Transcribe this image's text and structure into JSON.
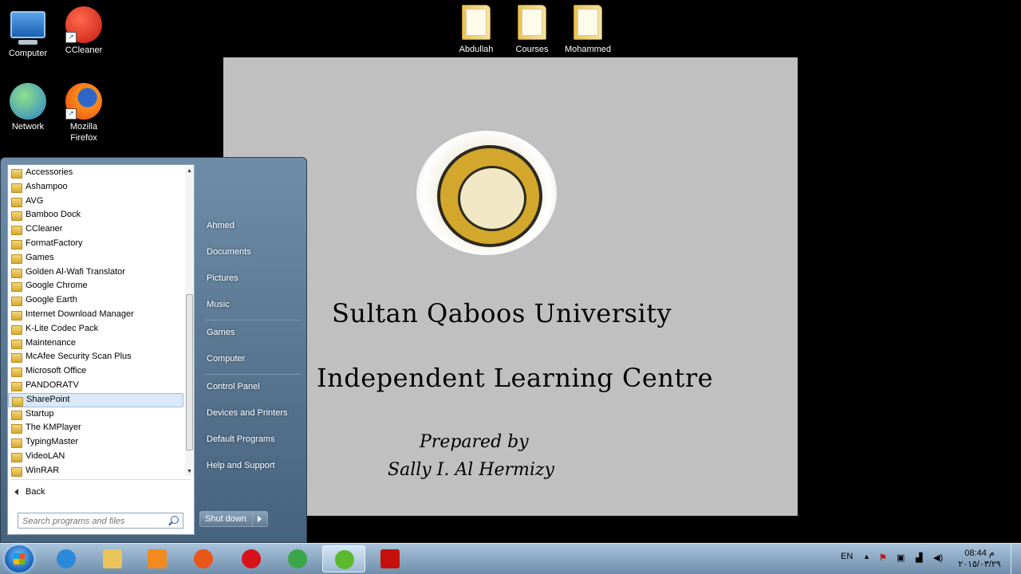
{
  "desktop": {
    "icons": [
      {
        "label": "Computer"
      },
      {
        "label": "CCleaner"
      },
      {
        "label": "Network"
      },
      {
        "label": "Mozilla Firefox"
      },
      {
        "label": "Abdullah"
      },
      {
        "label": "Courses"
      },
      {
        "label": "Mohammed"
      }
    ]
  },
  "slide": {
    "title": "Sultan Qaboos University",
    "subtitle": "Independent Learning Centre",
    "prepared_by": "Prepared by",
    "author": "Sally I. Al Hermizy"
  },
  "start_menu": {
    "programs": [
      "Accessories",
      "Ashampoo",
      "AVG",
      "Bamboo Dock",
      "CCleaner",
      "FormatFactory",
      "Games",
      "Golden Al-Wafi Translator",
      "Google Chrome",
      "Google Earth",
      "Internet Download Manager",
      "K-Lite Codec Pack",
      "Maintenance",
      "McAfee Security Scan Plus",
      "Microsoft Office",
      "PANDORATV",
      "SharePoint",
      "Startup",
      "The KMPlayer",
      "TypingMaster",
      "VideoLAN",
      "WinRAR"
    ],
    "selected_program": "SharePoint",
    "back_label": "Back",
    "search_placeholder": "Search programs and files",
    "right_items": [
      "Ahmed",
      "Documents",
      "Pictures",
      "Music",
      "Games",
      "Computer",
      "Control Panel",
      "Devices and Printers",
      "Default Programs",
      "Help and Support"
    ],
    "shutdown_label": "Shut down"
  },
  "taskbar": {
    "pinned": [
      {
        "icon": "internet-explorer-icon",
        "color": "#2a8ad9"
      },
      {
        "icon": "windows-explorer-icon",
        "color": "#e9c55a"
      },
      {
        "icon": "media-player-icon",
        "color": "#f28a1e"
      },
      {
        "icon": "firefox-icon",
        "color": "#e8561a"
      },
      {
        "icon": "opera-icon",
        "color": "#d8121b"
      },
      {
        "icon": "chrome-icon",
        "color": "#3ba54a"
      },
      {
        "icon": "utorrent-icon",
        "color": "#5cb82d"
      },
      {
        "icon": "adobe-reader-icon",
        "color": "#c4110e"
      }
    ],
    "language": "EN",
    "time": "08:44 م",
    "date": "٢٠١٥/٠٣/٢٩"
  }
}
